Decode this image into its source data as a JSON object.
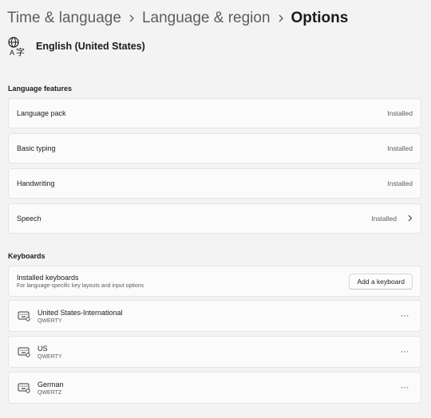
{
  "breadcrumb": {
    "items": [
      "Time & language",
      "Language & region",
      "Options"
    ]
  },
  "language": {
    "icon": "language-icon",
    "name": "English (United States)"
  },
  "language_features": {
    "title": "Language features",
    "rows": [
      {
        "label": "Language pack",
        "status": "Installed"
      },
      {
        "label": "Basic typing",
        "status": "Installed"
      },
      {
        "label": "Handwriting",
        "status": "Installed"
      },
      {
        "label": "Speech",
        "status": "Installed"
      }
    ]
  },
  "keyboards": {
    "title": "Keyboards",
    "installed": {
      "title": "Installed keyboards",
      "subtitle": "For language-specific key layouts and input options",
      "add_button": "Add a keyboard"
    },
    "items": [
      {
        "name": "United States-International",
        "layout": "QWERTY"
      },
      {
        "name": "US",
        "layout": "QWERTY"
      },
      {
        "name": "German",
        "layout": "QWERTZ"
      }
    ],
    "more_label": "···"
  }
}
